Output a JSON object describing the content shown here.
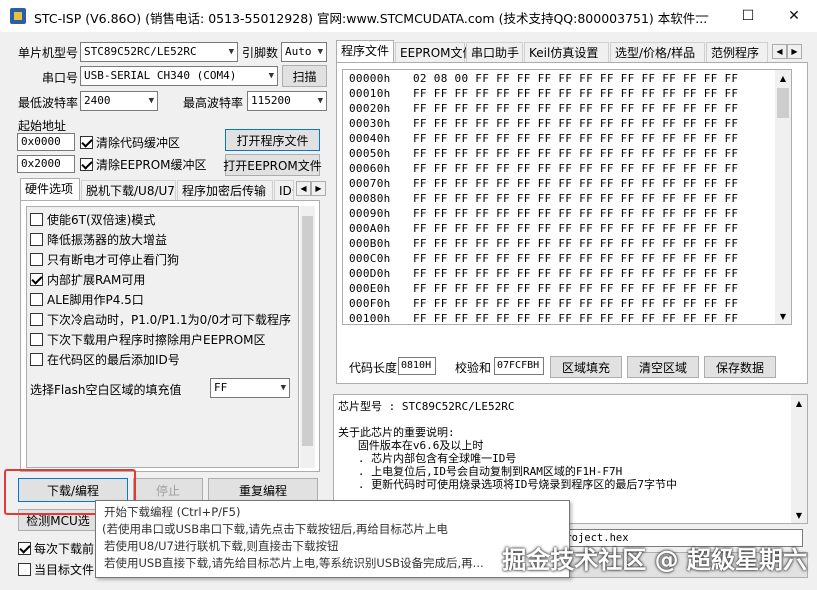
{
  "window": {
    "title": "STC-ISP (V6.86O) (销售电话: 0513-55012928) 官网:www.STCMCUDATA.com (技术支持QQ:800003751) 本软件...",
    "minimize_glyph": "—",
    "maximize_glyph": "☐",
    "close_glyph": "✕"
  },
  "left": {
    "mcu_label": "单片机型号",
    "mcu_value": "STC89C52RC/LE52RC",
    "pin_label": "引脚数",
    "pin_value": "Auto",
    "port_label": "串口号",
    "port_value": "USB-SERIAL CH340 (COM4)",
    "scan_button": "扫描",
    "min_baud_label": "最低波特率",
    "min_baud_value": "2400",
    "max_baud_label": "最高波特率",
    "max_baud_value": "115200",
    "start_addr_label": "起始地址",
    "addr1_value": "0x0000",
    "clear_code_label": "清除代码缓冲区",
    "open_program_button": "打开程序文件",
    "addr2_value": "0x2000",
    "clear_eeprom_label": "清除EEPROM缓冲区",
    "open_eeprom_button": "打开EEPROM文件",
    "tabs": [
      "硬件选项",
      "脱机下载/U8/U7",
      "程序加密后传输",
      "ID号"
    ],
    "options": [
      {
        "label": "使能6T(双倍速)模式",
        "checked": false
      },
      {
        "label": "降低振荡器的放大增益",
        "checked": false
      },
      {
        "label": "只有断电才可停止看门狗",
        "checked": false
      },
      {
        "label": "内部扩展RAM可用",
        "checked": true
      },
      {
        "label": "ALE脚用作P4.5口",
        "checked": false
      },
      {
        "label": "下次冷启动时，P1.0/P1.1为0/0才可下载程序",
        "checked": false
      },
      {
        "label": "下次下载用户程序时擦除用户EEPROM区",
        "checked": false
      },
      {
        "label": "在代码区的最后添加ID号",
        "checked": false
      }
    ],
    "flash_fill_label": "选择Flash空白区域的填充值",
    "flash_fill_value": "FF",
    "download_button": "下载/编程",
    "stop_button": "停止",
    "reprogram_button": "重复编程",
    "detect_button": "检测MCU选",
    "every_download_label": "每次下载前",
    "target_file_label": "当目标文件"
  },
  "right": {
    "tabs": [
      "程序文件",
      "EEPROM文件",
      "串口助手",
      "Keil仿真设置",
      "选型/价格/样品",
      "范例程序"
    ],
    "hex_rows": [
      {
        "addr": "00000h",
        "bytes": "02 08 00 FF FF FF FF FF FF FF FF FF FF FF FF FF"
      },
      {
        "addr": "00010h",
        "bytes": "FF FF FF FF FF FF FF FF FF FF FF FF FF FF FF FF"
      },
      {
        "addr": "00020h",
        "bytes": "FF FF FF FF FF FF FF FF FF FF FF FF FF FF FF FF"
      },
      {
        "addr": "00030h",
        "bytes": "FF FF FF FF FF FF FF FF FF FF FF FF FF FF FF FF"
      },
      {
        "addr": "00040h",
        "bytes": "FF FF FF FF FF FF FF FF FF FF FF FF FF FF FF FF"
      },
      {
        "addr": "00050h",
        "bytes": "FF FF FF FF FF FF FF FF FF FF FF FF FF FF FF FF"
      },
      {
        "addr": "00060h",
        "bytes": "FF FF FF FF FF FF FF FF FF FF FF FF FF FF FF FF"
      },
      {
        "addr": "00070h",
        "bytes": "FF FF FF FF FF FF FF FF FF FF FF FF FF FF FF FF"
      },
      {
        "addr": "00080h",
        "bytes": "FF FF FF FF FF FF FF FF FF FF FF FF FF FF FF FF"
      },
      {
        "addr": "00090h",
        "bytes": "FF FF FF FF FF FF FF FF FF FF FF FF FF FF FF FF"
      },
      {
        "addr": "000A0h",
        "bytes": "FF FF FF FF FF FF FF FF FF FF FF FF FF FF FF FF"
      },
      {
        "addr": "000B0h",
        "bytes": "FF FF FF FF FF FF FF FF FF FF FF FF FF FF FF FF"
      },
      {
        "addr": "000C0h",
        "bytes": "FF FF FF FF FF FF FF FF FF FF FF FF FF FF FF FF"
      },
      {
        "addr": "000D0h",
        "bytes": "FF FF FF FF FF FF FF FF FF FF FF FF FF FF FF FF"
      },
      {
        "addr": "000E0h",
        "bytes": "FF FF FF FF FF FF FF FF FF FF FF FF FF FF FF FF"
      },
      {
        "addr": "000F0h",
        "bytes": "FF FF FF FF FF FF FF FF FF FF FF FF FF FF FF FF"
      },
      {
        "addr": "00100h",
        "bytes": "FF FF FF FF FF FF FF FF FF FF FF FF FF FF FF FF"
      }
    ],
    "code_len_label": "代码长度",
    "code_len_value": "0810H",
    "checksum_label": "校验和",
    "checksum_value": "07FCFBH",
    "fill_button": "区域填充",
    "clear_button": "清空区域",
    "save_button": "保存数据",
    "log_lines": [
      "芯片型号 : STC89C52RC/LE52RC",
      "",
      "关于此芯片的重要说明:",
      "   固件版本在v6.6及以上时",
      "   . 芯片内部包含有全球唯一ID号",
      "   . 上电复位后,ID号会自动复制到RAM区域的F1H-F7H",
      "   . 更新代码时可使用烧录选项将ID号烧录到程序区的最后7字节中"
    ],
    "file_path_fragment": "project.hex"
  },
  "tooltip": {
    "lines": [
      "开始下载编程 (Ctrl+P/F5)",
      "(若使用串口或USB串口下载,请先点击下载按钮后,再给目标芯片上电",
      "若使用U8/U7进行联机下载,则直接击下载按钮",
      "若使用USB直接下载,请先给目标芯片上电,等系统识别USB设备完成后,再..."
    ]
  },
  "watermark": "掘金技术社区 @ 超級星期六",
  "colors": {
    "accent": "#0078d7",
    "highlight_box": "#e53935"
  }
}
